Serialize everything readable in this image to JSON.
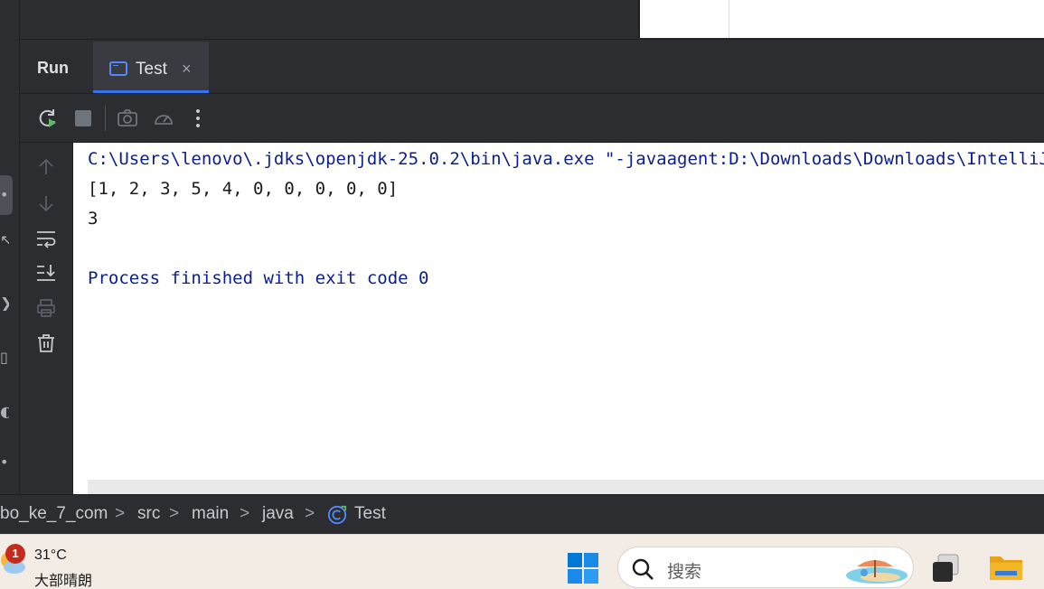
{
  "run_panel": {
    "title": "Run",
    "tabs": [
      {
        "label": "Test",
        "icon": "console-window-icon",
        "active": true,
        "close_icon": "close-icon",
        "close_glyph": "×"
      }
    ]
  },
  "toolbar": {
    "buttons": [
      {
        "name": "rerun-icon"
      },
      {
        "name": "stop-icon"
      },
      {
        "name": "camera-icon"
      },
      {
        "name": "profiler-gauge-icon"
      },
      {
        "name": "more-vertical-icon"
      }
    ]
  },
  "side_toolbar": {
    "buttons": [
      {
        "name": "up-arrow-icon"
      },
      {
        "name": "down-arrow-icon"
      },
      {
        "name": "soft-wrap-icon"
      },
      {
        "name": "scroll-to-end-icon"
      },
      {
        "name": "print-icon"
      },
      {
        "name": "trash-icon"
      }
    ]
  },
  "console": {
    "lines": [
      "C:\\Users\\lenovo\\.jdks\\openjdk-25.0.2\\bin\\java.exe \"-javaagent:D:\\Downloads\\Downloads\\IntelliJ",
      "[1, 2, 3, 5, 4, 0, 0, 0, 0, 0]",
      "3",
      "",
      "Process finished with exit code 0"
    ]
  },
  "breadcrumb": {
    "items": [
      "bo_ke_7_com",
      "src",
      "main",
      "java",
      "Test"
    ],
    "separator": ">",
    "last_icon": "java-class-icon"
  },
  "taskbar": {
    "weather": {
      "badge": "1",
      "temperature": "31°C",
      "description": "大部晴朗",
      "icon": "partly-sunny-icon"
    },
    "search_placeholder": "搜索",
    "colors": {
      "accent": "#3574f0",
      "start": "#0078d4",
      "folder": "#f4b728"
    }
  },
  "left_strip_icons": [
    {
      "glyph": "•"
    },
    {
      "glyph": "↖"
    },
    {
      "glyph": "❯"
    },
    {
      "glyph": "▯"
    },
    {
      "glyph": "◐"
    },
    {
      "glyph": "•"
    }
  ]
}
